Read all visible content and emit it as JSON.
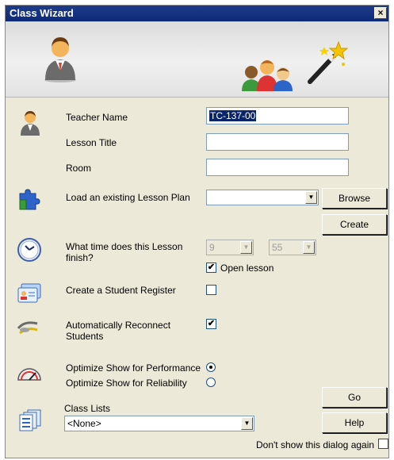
{
  "window": {
    "title": "Class Wizard",
    "close_label": "×"
  },
  "teacher": {
    "label": "Teacher Name",
    "value": "TC-137-00"
  },
  "lesson_title": {
    "label": "Lesson Title",
    "value": ""
  },
  "room": {
    "label": "Room",
    "value": ""
  },
  "lesson_plan": {
    "label": "Load an existing Lesson Plan",
    "value": "",
    "browse_label": "Browse",
    "create_label": "Create"
  },
  "finish_time": {
    "label_line1": "What time does this Lesson",
    "label_line2": "finish?",
    "hour": "9",
    "minute": "55",
    "open_lesson_label": "Open lesson",
    "open_lesson_checked": true
  },
  "register": {
    "label": "Create a Student Register",
    "checked": false
  },
  "reconnect": {
    "label_line1": "Automatically Reconnect",
    "label_line2": "Students",
    "checked": true
  },
  "optimize": {
    "performance_label": "Optimize Show for Performance",
    "reliability_label": "Optimize Show for Reliability",
    "selected": "performance"
  },
  "class_lists": {
    "label": "Class Lists",
    "value": "<None>"
  },
  "buttons": {
    "go_label": "Go",
    "help_label": "Help"
  },
  "dont_show": {
    "label": "Don't show this dialog again",
    "checked": false
  },
  "check_mark": "✔",
  "icons": [
    "teacher-icon",
    "students-group-icon",
    "magic-wand-icon",
    "puzzle-icon",
    "clock-icon",
    "register-card-icon",
    "reconnect-icon",
    "gauge-icon",
    "class-lists-icon"
  ]
}
